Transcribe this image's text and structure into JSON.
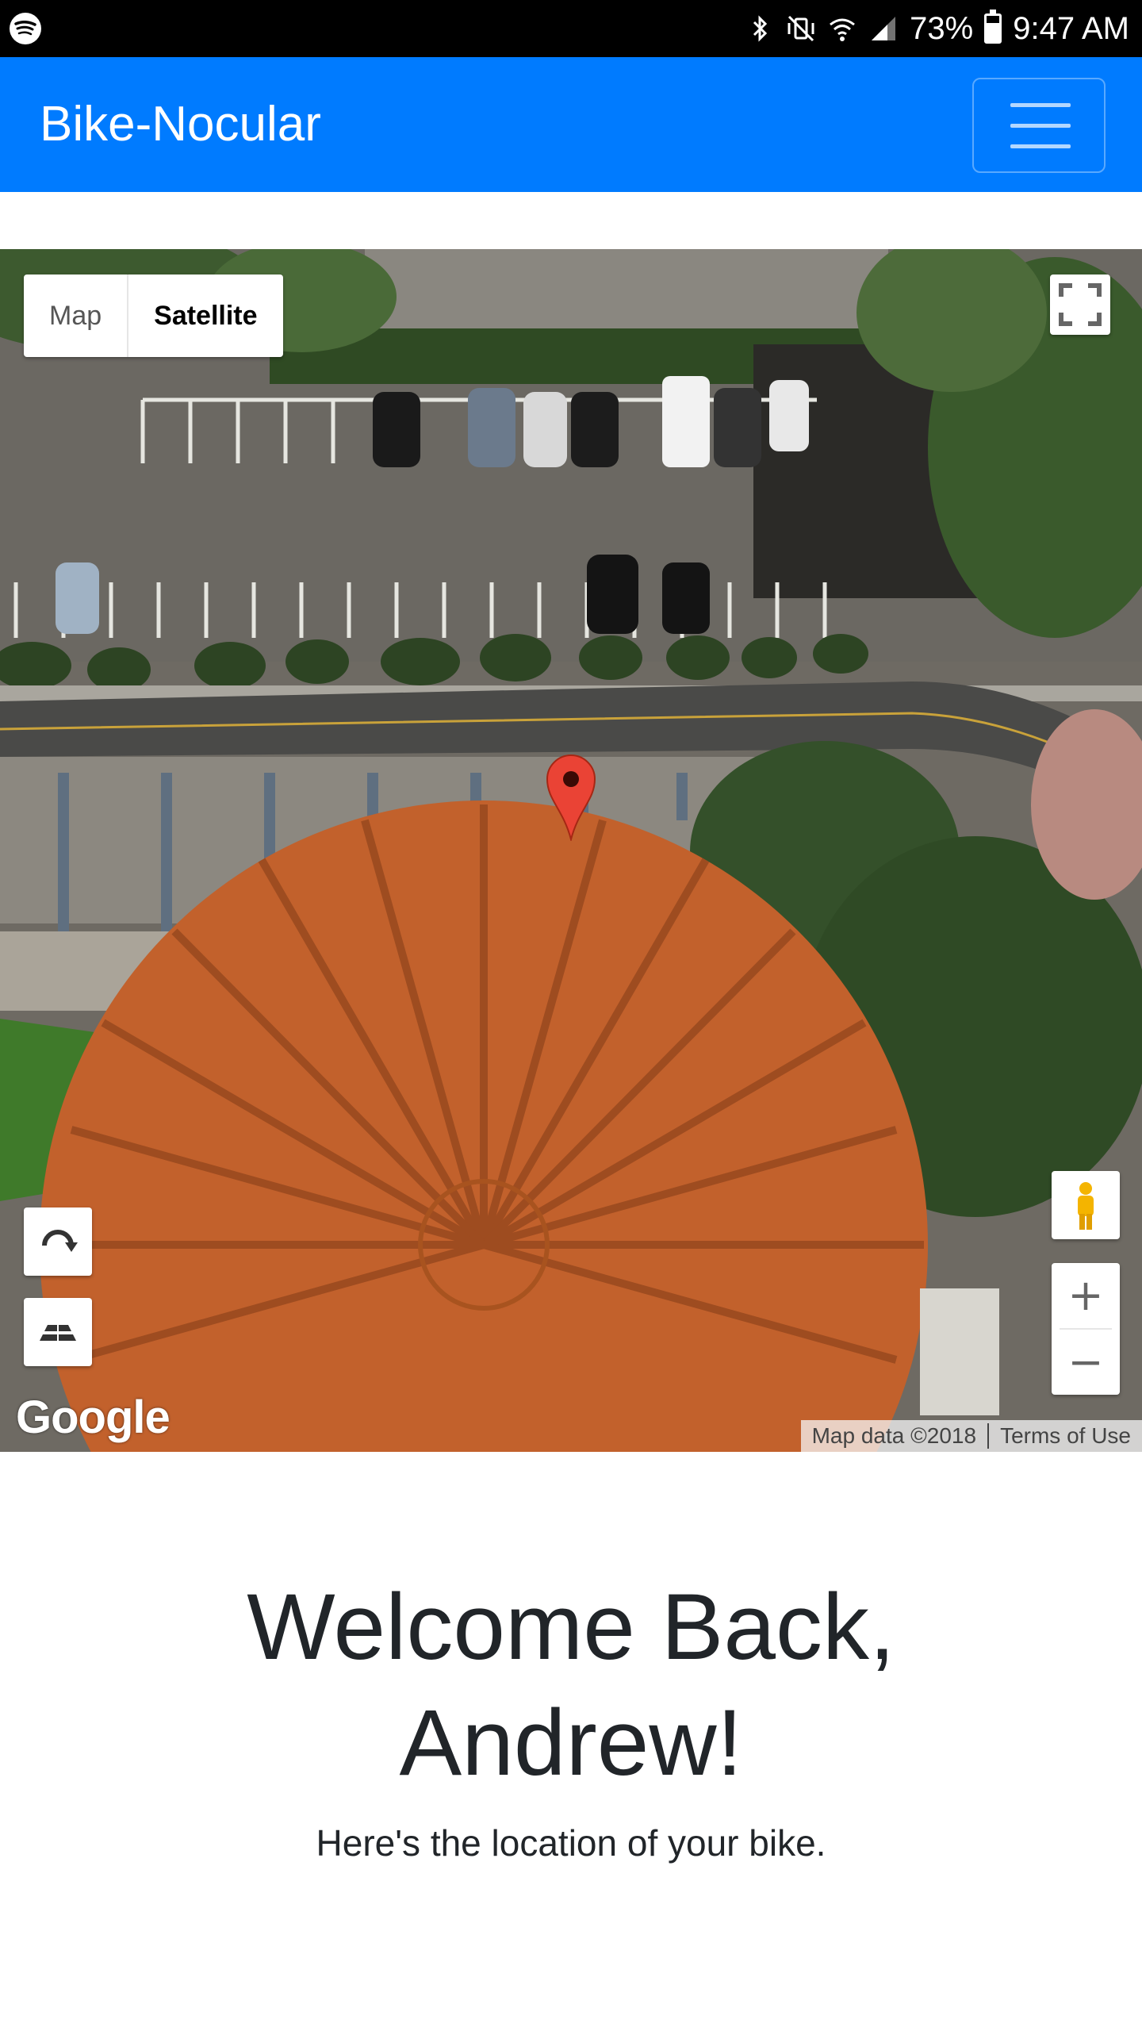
{
  "status_bar": {
    "battery": "73%",
    "time": "9:47 AM",
    "icons": [
      "spotify-icon",
      "bluetooth-icon",
      "vibrate-icon",
      "wifi-icon",
      "signal-icon",
      "battery-icon"
    ],
    "battery_level": 0.73
  },
  "navbar": {
    "brand": "Bike-Nocular",
    "color": "#007bff"
  },
  "map": {
    "type_controls": {
      "map_label": "Map",
      "satellite_label": "Satellite",
      "selected": "Satellite"
    },
    "zoom_in": "+",
    "zoom_out": "−",
    "logo": "Google",
    "attribution": "Map data ©2018",
    "terms": "Terms of Use"
  },
  "welcome": {
    "line1": "Welcome Back,",
    "line2": "Andrew!",
    "subtitle": "Here's the location of your bike."
  }
}
